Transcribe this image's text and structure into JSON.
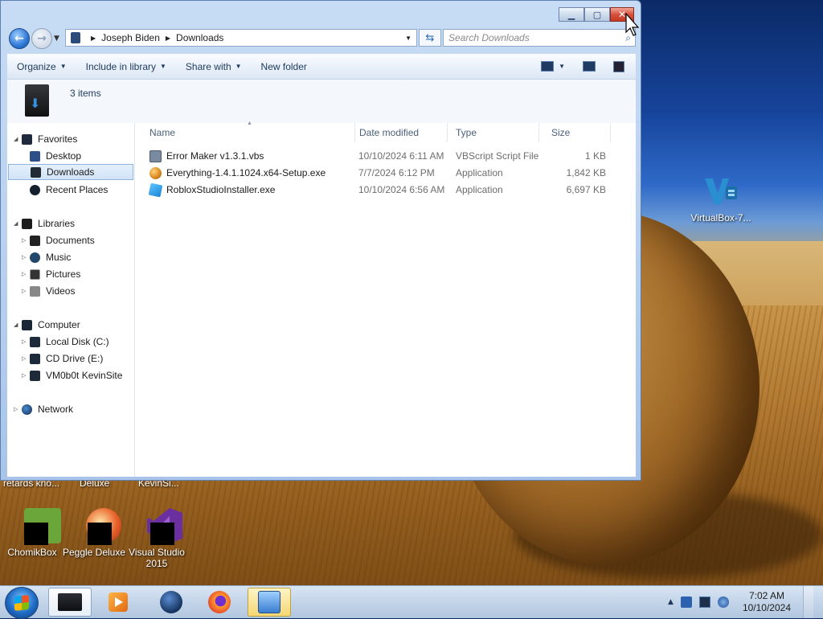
{
  "desktop": {
    "icons": [
      {
        "label": "VirtualBox-7...",
        "icon": "virtualbox-icon"
      },
      {
        "label": "ChomikBox",
        "icon": "chomikbox-icon"
      },
      {
        "label": "Peggle Deluxe",
        "icon": "peggle-icon"
      },
      {
        "label": "Visual Studio 2015",
        "icon": "visual-studio-icon"
      }
    ],
    "partial_labels": [
      "retards kno...",
      "Deluxe",
      "KevinSi..."
    ]
  },
  "window": {
    "address": {
      "crumbs": [
        "Joseph Biden",
        "Downloads"
      ]
    },
    "search": {
      "placeholder": "Search Downloads"
    },
    "toolbar": {
      "organize": "Organize",
      "include_in_library": "Include in library",
      "share_with": "Share with",
      "new_folder": "New folder"
    },
    "details": {
      "count": "3 items"
    },
    "nav": {
      "favorites": "Favorites",
      "downloads": "Downloads",
      "desktop": "Desktop",
      "recent_places": "Recent Places",
      "libraries": "Libraries",
      "documents": "Documents",
      "music": "Music",
      "pictures": "Pictures",
      "videos": "Videos",
      "computer": "Computer",
      "local_disk": "Local Disk (C:)",
      "cd_drive": "CD Drive (E:)",
      "vm_share": "VM0b0t KevinSite",
      "network": "Network"
    },
    "columns": {
      "name": "Name",
      "date": "Date modified",
      "type": "Type",
      "size": "Size"
    },
    "files": [
      {
        "name": "Error Maker v1.3.1.vbs",
        "date": "10/10/2024 6:11 AM",
        "type": "VBScript Script File",
        "size": "1 KB",
        "icon": "vbs-script-icon",
        "color": "#7a8aa0"
      },
      {
        "name": "Everything-1.4.1.1024.x64-Setup.exe",
        "date": "7/7/2024 6:12 PM",
        "type": "Application",
        "size": "1,842 KB",
        "icon": "magnifier-app-icon",
        "color": "#d9861c"
      },
      {
        "name": "RobloxStudioInstaller.exe",
        "date": "10/10/2024 6:56 AM",
        "type": "Application",
        "size": "6,697 KB",
        "icon": "roblox-studio-icon",
        "color": "#2aa0e8"
      }
    ]
  },
  "taskbar": {
    "clock_time": "7:02 AM",
    "clock_date": "10/10/2024"
  }
}
